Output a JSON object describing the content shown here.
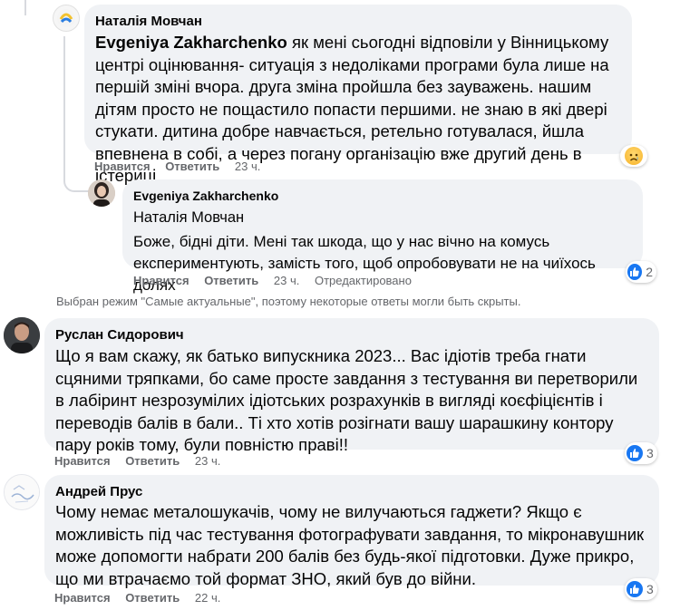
{
  "comments": [
    {
      "author": "Наталія Мовчан",
      "mention": "Evgeniya Zakharchenko",
      "text": "як мені сьогодні відповіли у Вінницькому центрі оцінювання- ситуація з недоліками програми була лише на першій зміні вчора. друга зміна пройшла без зауважень. нашим дітям просто не пощастило попасти першими. не знаю в які двері стукати. дитина добре навчається, ретельно готувалася, йшла впевнена в собі, а через погану організацію вже другий день в істериці",
      "like_label": "Нравится",
      "reply_label": "Ответить",
      "time": "23 ч.",
      "reaction": "sad"
    },
    {
      "author": "Evgeniya Zakharchenko",
      "mention": "Наталія Мовчан",
      "text": "Боже, бідні діти. Мені так шкода, що у нас вічно на комусь експериментують, замість того, щоб опробовувати не на чиїхось долях",
      "like_label": "Нравится",
      "reply_label": "Ответить",
      "time": "23 ч.",
      "edited": "Отредактировано",
      "reaction_count": "2"
    },
    {
      "author": "Руслан Сидорович",
      "text": "Що я вам скажу, як батько випускника 2023... Вас ідіотів треба гнати сцяними тряпками, бо саме просте завдання з тестування ви перетворили в лабіринт незрозумілих ідіотських розрахунків в вигляді коєфіцієнтів і переводів балів в бали.. Ті хто хотів розігнати вашу шарашкину контору пару років тому, були повністю праві!!",
      "like_label": "Нравится",
      "reply_label": "Ответить",
      "time": "23 ч.",
      "reaction_count": "3"
    },
    {
      "author": "Андрей Прус",
      "text": "Чому немає металошукачів, чому не вилучаються гаджети? Якщо є можливість під час тестування фотографувати завдання, то мікронавушник може допомогти набрати 200 балів без будь-якої підготовки. Дуже прикро, що ми втрачаємо той формат ЗНО, який був до війни.",
      "like_label": "Нравится",
      "reply_label": "Ответить",
      "time": "22 ч.",
      "reaction_count": "3"
    }
  ],
  "notice": "Выбран режим \"Самые актуальные\", поэтому некоторые ответы могли быть скрыты.",
  "colors": {
    "bubble": "#f0f2f5",
    "meta": "#65676b",
    "like_blue": "#1877f2"
  }
}
